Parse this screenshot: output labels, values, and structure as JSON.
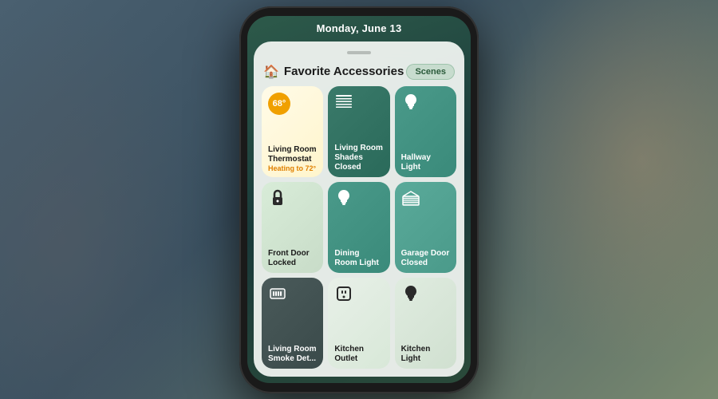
{
  "background": {
    "color": "#5a7a8a"
  },
  "phone": {
    "date": "Monday, June 13",
    "screen": {
      "card": {
        "pull_indicator": true,
        "header": {
          "title": "Favorite Accessories",
          "scenes_button": "Scenes"
        },
        "tiles": [
          {
            "id": "thermostat",
            "temp": "68°",
            "label": "Living Room Thermostat",
            "sub": "Heating to 72°",
            "icon": "thermometer"
          },
          {
            "id": "shades",
            "label": "Living Room Shades",
            "sub": "Closed",
            "icon": "shades"
          },
          {
            "id": "hallway-light",
            "label": "Hallway Light",
            "sub": "",
            "icon": "bulb"
          },
          {
            "id": "front-door",
            "label": "Front Door",
            "sub": "Locked",
            "icon": "lock"
          },
          {
            "id": "dining-light",
            "label": "Dining Room Light",
            "sub": "",
            "icon": "bulb"
          },
          {
            "id": "garage-door",
            "label": "Garage Door",
            "sub": "Closed",
            "icon": "garage"
          },
          {
            "id": "smoke-det",
            "label": "Living Room Smoke Det...",
            "sub": "",
            "icon": "smoke"
          },
          {
            "id": "kitchen-outlet",
            "label": "Kitchen Outlet",
            "sub": "",
            "icon": "outlet"
          },
          {
            "id": "kitchen-light",
            "label": "Kitchen Light",
            "sub": "",
            "icon": "bulb"
          }
        ]
      }
    }
  }
}
